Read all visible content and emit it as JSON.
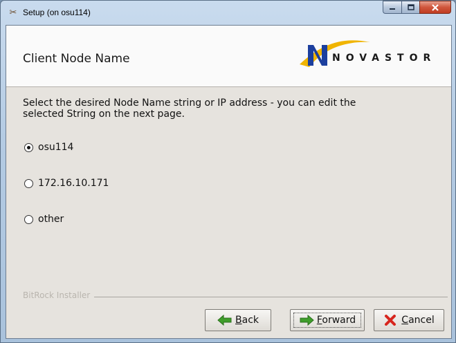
{
  "window": {
    "title": "Setup (on osu114)",
    "icon": "setup-app-icon",
    "caption_buttons": {
      "minimize": "minimize-icon",
      "maximize": "maximize-icon",
      "close": "close-icon"
    }
  },
  "header": {
    "title": "Client Node Name",
    "logo_text": "NOVASTOR"
  },
  "instructions": "Select the desired Node Name string or IP address - you can edit the\nselected String on the next page.",
  "options": [
    {
      "label": "osu114",
      "checked": true
    },
    {
      "label": "172.16.10.171",
      "checked": false
    },
    {
      "label": "other",
      "checked": false
    }
  ],
  "footer": {
    "installer_label": "BitRock Installer"
  },
  "buttons": {
    "back": {
      "mnemonic": "B",
      "rest": "ack",
      "icon": "arrow-left-icon"
    },
    "forward": {
      "mnemonic": "F",
      "rest": "orward",
      "icon": "arrow-right-icon"
    },
    "cancel": {
      "mnemonic": "C",
      "rest": "ancel",
      "icon": "cancel-x-icon"
    }
  },
  "colors": {
    "arrow_green": "#3f9e2b",
    "cancel_red": "#d7261e",
    "logo_blue": "#1c3f9e",
    "logo_gold": "#f0b400"
  }
}
